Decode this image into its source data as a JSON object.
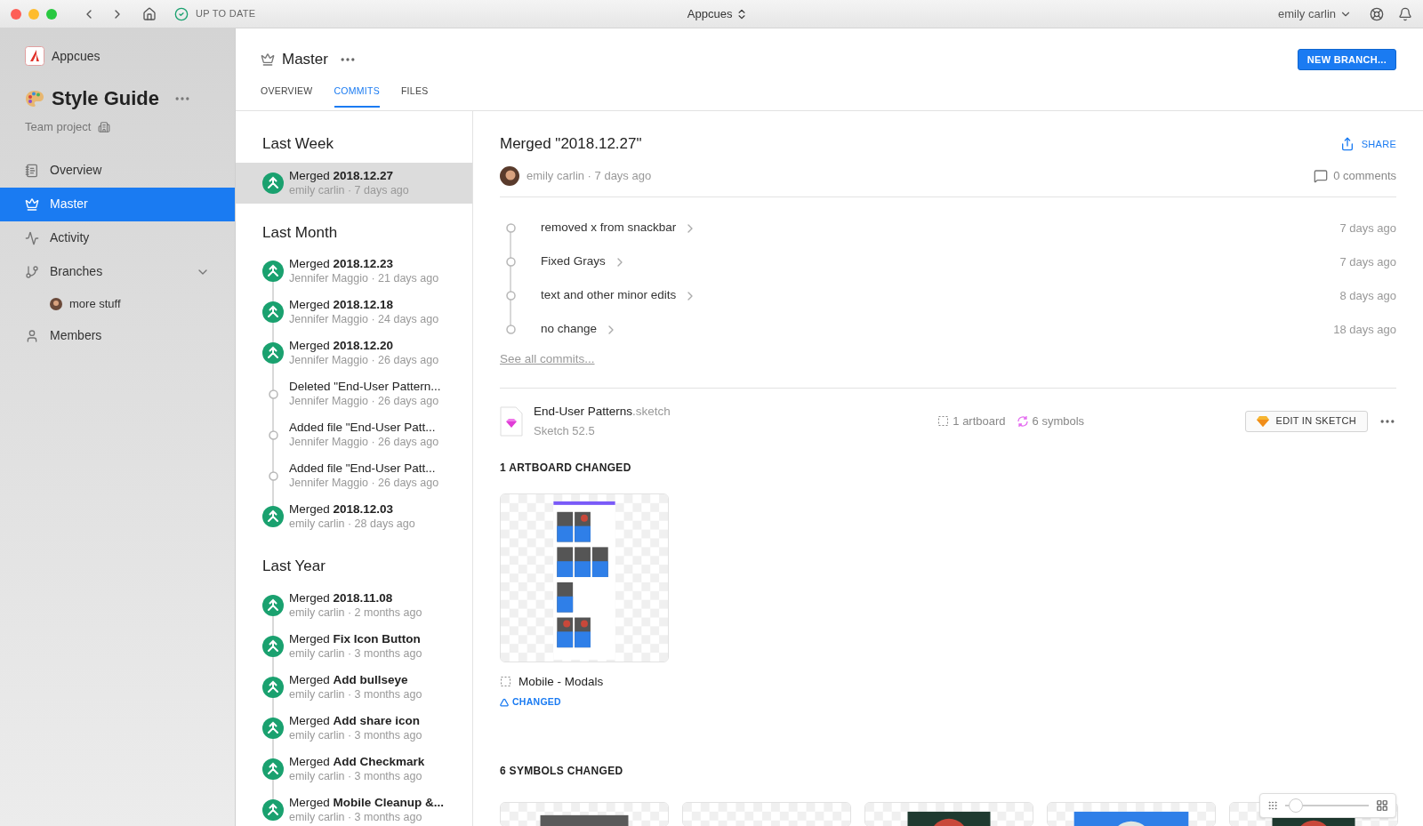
{
  "titlebar": {
    "status": "UP TO DATE",
    "project_switcher": "Appcues",
    "user": "emily carlin"
  },
  "sidebar": {
    "org": "Appcues",
    "project": "Style Guide",
    "project_type": "Team project",
    "items": [
      {
        "label": "Overview",
        "selected": false
      },
      {
        "label": "Master",
        "selected": true
      },
      {
        "label": "Activity",
        "selected": false
      },
      {
        "label": "Branches",
        "selected": false,
        "expanded": true,
        "children": [
          {
            "label": "more stuff",
            "selected": false
          }
        ]
      },
      {
        "label": "Members",
        "selected": false
      }
    ]
  },
  "header": {
    "title": "Master",
    "new_branch": "NEW BRANCH...",
    "tabs": [
      {
        "label": "OVERVIEW",
        "selected": false
      },
      {
        "label": "COMMITS",
        "selected": true
      },
      {
        "label": "FILES",
        "selected": false
      }
    ]
  },
  "commit_groups": [
    {
      "title": "Last Week",
      "commits": [
        {
          "kind": "merge",
          "title": "Merged **2018.12.27**",
          "meta": "emily carlin · 7 days ago",
          "selected": true
        }
      ]
    },
    {
      "title": "Last Month",
      "commits": [
        {
          "kind": "merge",
          "title": "Merged **2018.12.23**",
          "meta": "Jennifer Maggio · 21 days ago",
          "selected": false
        },
        {
          "kind": "merge",
          "title": "Merged **2018.12.18**",
          "meta": "Jennifer Maggio · 24 days ago",
          "selected": false
        },
        {
          "kind": "merge",
          "title": "Merged **2018.12.20**",
          "meta": "Jennifer Maggio · 26 days ago",
          "selected": false
        },
        {
          "kind": "change",
          "title": "Deleted \"End-User Pattern...",
          "meta": "Jennifer Maggio · 26 days ago",
          "selected": false
        },
        {
          "kind": "change",
          "title": "Added file \"End-User Patt...",
          "meta": "Jennifer Maggio · 26 days ago",
          "selected": false
        },
        {
          "kind": "change",
          "title": "Added file \"End-User Patt...",
          "meta": "Jennifer Maggio · 26 days ago",
          "selected": false
        },
        {
          "kind": "merge",
          "title": "Merged **2018.12.03**",
          "meta": "emily carlin · 28 days ago",
          "selected": false
        }
      ]
    },
    {
      "title": "Last Year",
      "commits": [
        {
          "kind": "merge",
          "title": "Merged **2018.11.08**",
          "meta": "emily carlin · 2 months ago",
          "selected": false
        },
        {
          "kind": "merge",
          "title": "Merged **Fix Icon Button**",
          "meta": "emily carlin · 3 months ago",
          "selected": false
        },
        {
          "kind": "merge",
          "title": "Merged **Add bullseye**",
          "meta": "emily carlin · 3 months ago",
          "selected": false
        },
        {
          "kind": "merge",
          "title": "Merged **Add share icon**",
          "meta": "emily carlin · 3 months ago",
          "selected": false
        },
        {
          "kind": "merge",
          "title": "Merged **Add Checkmark**",
          "meta": "emily carlin · 3 months ago",
          "selected": false
        },
        {
          "kind": "merge",
          "title": "Merged **Mobile Cleanup &...**",
          "meta": "emily carlin · 3 months ago",
          "selected": false
        }
      ]
    }
  ],
  "detail": {
    "title": "Merged \"2018.12.27\"",
    "share": "SHARE",
    "author": "emily carlin · 7 days ago",
    "comments": "0 comments",
    "changes": [
      {
        "message": "removed x from snackbar",
        "time": "7 days ago"
      },
      {
        "message": "Fixed Grays",
        "time": "7 days ago"
      },
      {
        "message": "text and other minor edits",
        "time": "8 days ago"
      },
      {
        "message": "no change",
        "time": "18 days ago"
      }
    ],
    "see_all": "See all commits...",
    "file": {
      "name": "End-User Patterns",
      "extension": ".sketch",
      "version": "Sketch 52.5",
      "artboards": "1 artboard",
      "symbols": "6 symbols",
      "edit": "EDIT IN SKETCH"
    },
    "artboard_section": "1 ARTBOARD CHANGED",
    "artboards": [
      {
        "name": "Mobile - Modals",
        "status": "CHANGED"
      }
    ],
    "symbol_section": "6 SYMBOLS CHANGED",
    "zoom": {
      "level": 0.05
    }
  }
}
